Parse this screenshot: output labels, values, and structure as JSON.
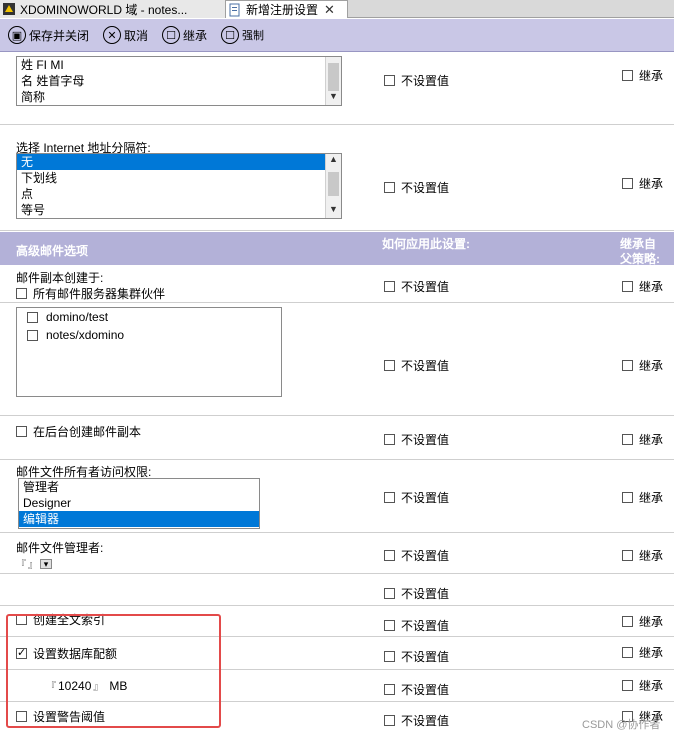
{
  "tabs": [
    {
      "label": "XDOMINOWORLD 域 - notes..."
    },
    {
      "label": "新增注册设置",
      "close": "✕"
    }
  ],
  "toolbar": {
    "save_close": "保存并关闭",
    "cancel": "取消",
    "inherit": "继承",
    "enforce": "强制",
    "save_icon_glyph": "▣",
    "cancel_icon_glyph": "✕",
    "inherit_icon_glyph": "☐",
    "enforce_icon_glyph": "☐"
  },
  "common": {
    "not_set": "不设置值",
    "inherit": "继承"
  },
  "name_format_list": [
    "姓 FI MI",
    "名 姓首字母",
    "简称"
  ],
  "internet_separator": {
    "label": "选择 Internet 地址分隔符:",
    "options": [
      "无",
      "下划线",
      "点",
      "等号"
    ],
    "selected": "无"
  },
  "section": {
    "title": "高级邮件选项",
    "how_apply": "如何应用此设置:",
    "inherit_parent_1": "继承自",
    "inherit_parent_2": "父策略:"
  },
  "replica": {
    "label": "邮件副本创建于:",
    "all_cluster": "所有邮件服务器集群伙伴",
    "servers": [
      "domino/test",
      "notes/xdomino"
    ]
  },
  "background_replica": "在后台创建邮件副本",
  "owner_access": {
    "label": "邮件文件所有者访问权限:",
    "options": [
      "管理者",
      "Designer",
      "编辑器"
    ],
    "selected": "编辑器"
  },
  "file_manager": {
    "label": "邮件文件管理者:",
    "dropdown_glyph": "▾"
  },
  "fulltext_index": "创建全文索引",
  "db_quota": {
    "label": "设置数据库配额",
    "checked": true,
    "value": "10240",
    "unit": "MB"
  },
  "warning_threshold": "设置警告阈值",
  "watermark": "CSDN @协作者"
}
